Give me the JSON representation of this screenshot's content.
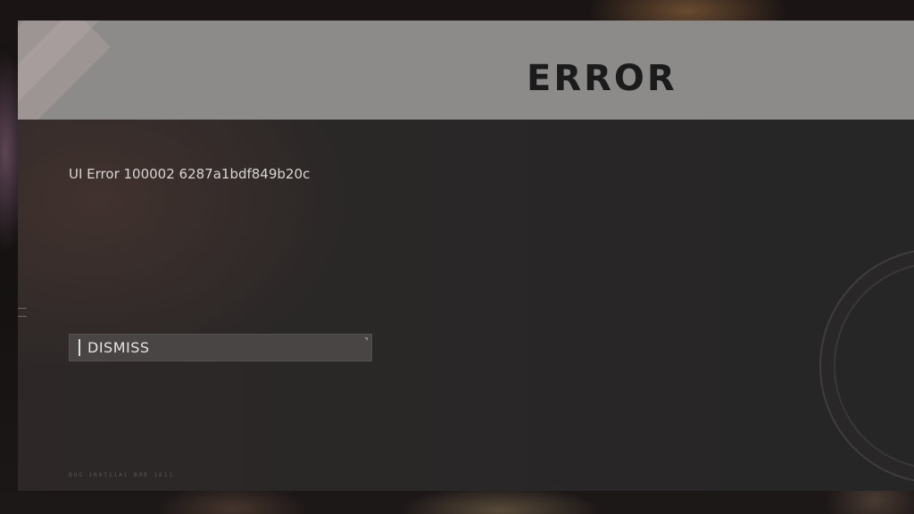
{
  "dialog": {
    "title": "ERROR",
    "message": "UI Error 100002 6287a1bdf849b20c",
    "dismiss_label": "DISMISS",
    "footer_code": "BUG 1N8T11A1 B0B 1611"
  },
  "icons": {
    "dismiss_corner": "corner-triangle-icon",
    "emblem": "circular-emblem-icon",
    "side_mark": "menu-lines-icon"
  },
  "colors": {
    "header_bg": "#8c8b8a",
    "panel_bg": "#2a2727",
    "title_text": "#1b1b1b",
    "button_bg": "#484544",
    "text": "#d8d6d4"
  }
}
